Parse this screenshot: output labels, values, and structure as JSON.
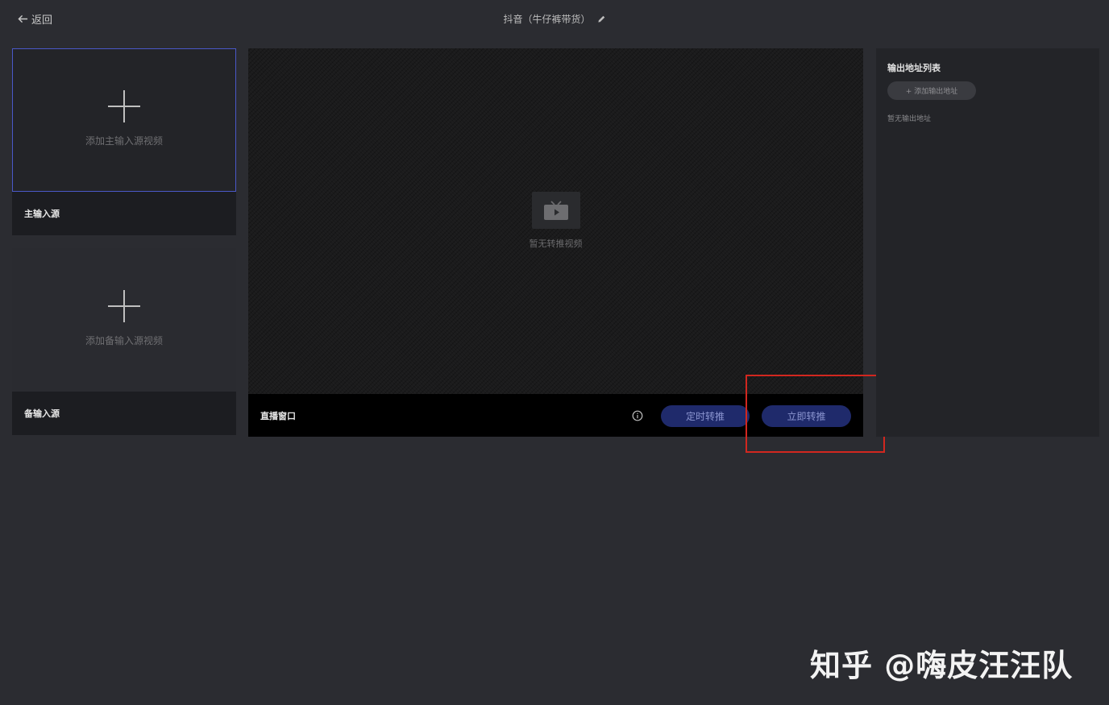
{
  "header": {
    "back_label": "返回",
    "title": "抖音（牛仔裤带货）"
  },
  "sources": {
    "main": {
      "add_label": "添加主输入源视频",
      "name": "主输入源"
    },
    "backup": {
      "add_label": "添加备输入源视频",
      "name": "备输入源"
    }
  },
  "preview": {
    "empty_text": "暂无转推视频",
    "window_title": "直播窗口",
    "schedule_button": "定时转推",
    "push_now_button": "立即转推"
  },
  "output": {
    "title": "输出地址列表",
    "add_button": "+ 添加输出地址",
    "empty_text": "暂无输出地址"
  },
  "watermark": "知乎 @嗨皮汪汪队",
  "colors": {
    "background": "#2b2c31",
    "accent_border": "#4a58c8",
    "button_bg": "#1f2a6b",
    "highlight": "#d2271f"
  },
  "icons": [
    "arrow-left-icon",
    "pencil-icon",
    "plus-icon",
    "tv-icon",
    "info-icon"
  ]
}
